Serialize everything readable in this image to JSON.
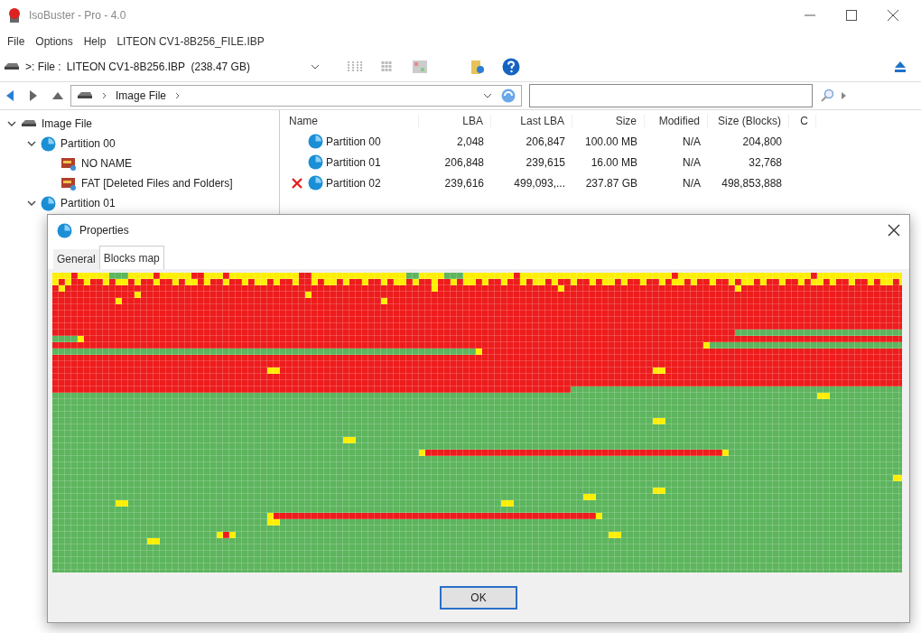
{
  "window": {
    "title": "IsoBuster - Pro - 4.0"
  },
  "menu": [
    "File",
    "Options",
    "Help",
    "LITEON CV1-8B256_FILE.IBP"
  ],
  "toolbar": {
    "drive_label": ">: File :",
    "drive_name": "LITEON CV1-8B256.IBP  (238.47 GB)"
  },
  "address": {
    "crumbs": [
      "Image File"
    ]
  },
  "tree": [
    {
      "label": "Image File",
      "kind": "drive",
      "expanded": true,
      "children": [
        {
          "label": "Partition 00",
          "kind": "partition",
          "expanded": true,
          "children": [
            {
              "label": "NO NAME",
              "kind": "volume"
            },
            {
              "label": "FAT [Deleted Files and Folders]",
              "kind": "volume"
            }
          ]
        },
        {
          "label": "Partition 01",
          "kind": "partition",
          "expanded": true
        }
      ]
    }
  ],
  "table": {
    "columns": [
      "Name",
      "LBA",
      "Last LBA",
      "Size",
      "Modified",
      "Size (Blocks)",
      "C"
    ],
    "rows": [
      {
        "error": false,
        "cells": [
          "Partition 00",
          "2,048",
          "206,847",
          "100.00 MB",
          "N/A",
          "204,800"
        ]
      },
      {
        "error": false,
        "cells": [
          "Partition 01",
          "206,848",
          "239,615",
          "16.00 MB",
          "N/A",
          "32,768"
        ]
      },
      {
        "error": true,
        "cells": [
          "Partition 02",
          "239,616",
          "499,093,...",
          "237.87 GB",
          "N/A",
          "498,853,888"
        ]
      }
    ]
  },
  "dialog": {
    "title": "Properties",
    "tabs": [
      {
        "label": "General",
        "selected": false
      },
      {
        "label": "Blocks map",
        "selected": true
      }
    ],
    "ok_button": "OK"
  }
}
